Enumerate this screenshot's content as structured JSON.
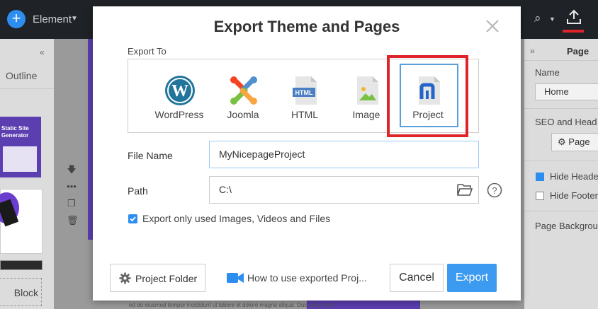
{
  "editor": {
    "toolbar": {
      "element_label": "Element"
    },
    "left_panel": {
      "outline_label": "Outline",
      "thumb_text": "Static Site Generator",
      "block_label": "Block"
    },
    "right_panel": {
      "title": "Page",
      "name_label": "Name",
      "name_value": "Home",
      "seo_label": "SEO and Head",
      "page_button": "Page",
      "hide_header": "Hide Header",
      "hide_footer": "Hide Footer",
      "page_background": "Page Background"
    },
    "bottom_text": "ed do eiusmod tempor incididunt ut labore et dolore magna aliqua. Duis aute irure"
  },
  "dialog": {
    "title": "Export Theme and Pages",
    "export_to_label": "Export To",
    "targets": [
      {
        "label": "WordPress",
        "icon": "wordpress-icon"
      },
      {
        "label": "Joomla",
        "icon": "joomla-icon"
      },
      {
        "label": "HTML",
        "icon": "html-file-icon"
      },
      {
        "label": "Image",
        "icon": "image-file-icon"
      },
      {
        "label": "Project",
        "icon": "nicepage-project-icon",
        "selected": true
      }
    ],
    "file_name_label": "File Name",
    "file_name_value": "MyNicepageProject",
    "path_label": "Path",
    "path_value": "C:\\",
    "checkbox_label": "Export only used Images, Videos and Files",
    "checkbox_checked": true,
    "project_folder_button": "Project Folder",
    "how_to_link": "How to use exported Proj...",
    "cancel_button": "Cancel",
    "export_button": "Export"
  },
  "colors": {
    "accent": "#3c9af0",
    "highlight": "#e0232b",
    "topbar": "#1f2226"
  }
}
